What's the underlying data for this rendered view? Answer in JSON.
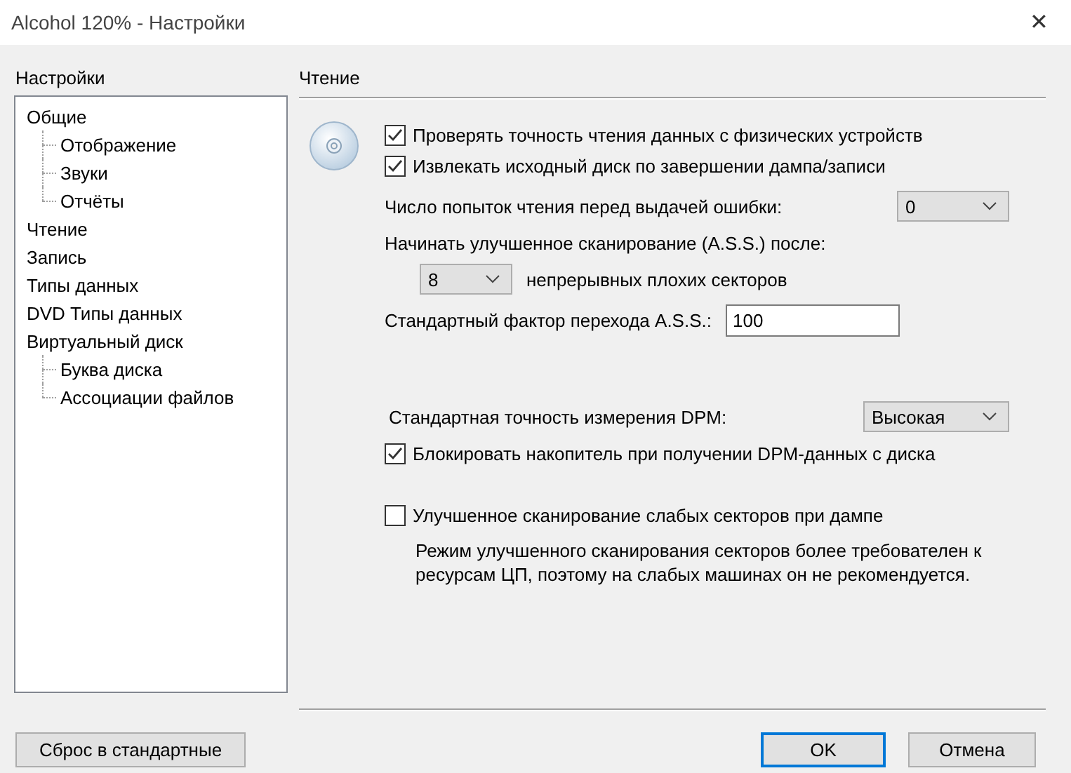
{
  "window": {
    "title": "Alcohol 120% - Настройки",
    "close": "✕"
  },
  "sidebar": {
    "title": "Настройки",
    "tree": [
      {
        "label": "Общие",
        "children": [
          {
            "label": "Отображение"
          },
          {
            "label": "Звуки"
          },
          {
            "label": "Отчёты"
          }
        ]
      },
      {
        "label": "Чтение"
      },
      {
        "label": "Запись"
      },
      {
        "label": "Типы данных"
      },
      {
        "label": "DVD Типы данных"
      },
      {
        "label": "Виртуальный диск",
        "children": [
          {
            "label": "Буква диска"
          },
          {
            "label": "Ассоциации файлов"
          }
        ]
      }
    ]
  },
  "panel": {
    "title": "Чтение",
    "groups": [
      {
        "items": [
          {
            "kind": "checkbox",
            "label": "Проверять точность чтения данных с физических устройств",
            "checked": true
          },
          {
            "kind": "checkbox",
            "label": "Извлекать исходный диск по завершении дампа/записи",
            "checked": true
          },
          {
            "kind": "select",
            "label": "Число попыток чтения перед выдачей ошибки:",
            "value": "0"
          },
          {
            "kind": "select_below",
            "label": "Начинать улучшенное сканирование (A.S.S.) после:",
            "value": "8",
            "unit": "непрерывных плохих секторов"
          },
          {
            "kind": "input",
            "label": "Стандартный фактор перехода A.S.S.:",
            "value": "100"
          }
        ]
      },
      {
        "items": [
          {
            "kind": "select",
            "label": "Стандартная точность измерения DPM:",
            "value": "Высокая"
          },
          {
            "kind": "checkbox",
            "label": "Блокировать накопитель при получении DPM-данных с диска",
            "checked": true
          }
        ]
      },
      {
        "items": [
          {
            "kind": "checkbox",
            "label": "Улучшенное сканирование слабых секторов при дампе",
            "checked": false
          },
          {
            "kind": "note",
            "label": "Режим улучшенного сканирования секторов более требователен к ресурсам ЦП, поэтому на слабых машинах он не рекомендуется."
          }
        ]
      }
    ]
  },
  "buttons": [
    {
      "label": "Сброс в стандартные",
      "kind": "reset",
      "default": false
    },
    {
      "label": "OK",
      "kind": "action",
      "default": true
    },
    {
      "label": "Отмена",
      "kind": "action",
      "default": false
    }
  ]
}
